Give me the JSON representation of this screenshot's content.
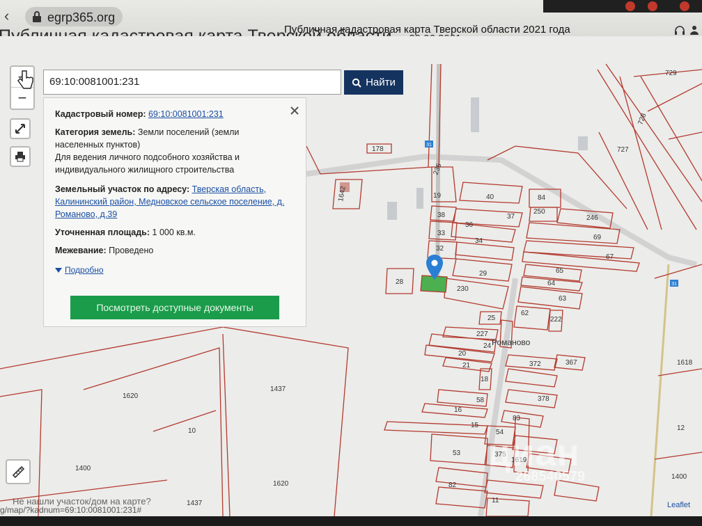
{
  "browser": {
    "url": "egrp365.org",
    "tab_title": "Публичная кадастровая карта Тверской области 2021 года"
  },
  "page": {
    "heading": "Публичная кадастровая карта Тверской области",
    "heading_date": "на 29.06.2021"
  },
  "search": {
    "value": "69:10:0081001:231",
    "button_label": "Найти"
  },
  "popup": {
    "cadastral_label": "Кадастровый номер:",
    "cadastral_value": "69:10:0081001:231",
    "category_label": "Категория земель:",
    "category_value_1": "Земли поселений (земли",
    "category_value_2": "населенных пунктов)",
    "usage_1": "Для ведения личного подсобного хозяйства и",
    "usage_2": "индивидуального жилищного строительства",
    "address_label": "Земельный участок по адресу:",
    "address_1": "Тверская область,",
    "address_2": "Калининский район, Медновское сельское поселение, д.",
    "address_3": "Романово, д.39",
    "area_label": "Уточненная площадь:",
    "area_value": "1 000 кв.м.",
    "survey_label": "Межевание:",
    "survey_value": "Проведено",
    "more_link": "Подробно",
    "docs_button": "Посмотреть доступные документы"
  },
  "map": {
    "parcel_labels": [
      "729",
      "728",
      "727",
      "178",
      "236",
      "19",
      "1642",
      "40",
      "84",
      "250",
      "246",
      "38",
      "36",
      "37",
      "69",
      "33",
      "34",
      "32",
      "67",
      "65",
      "28",
      "29",
      "64",
      "230",
      "63",
      "62",
      "222",
      "25",
      "227",
      "24",
      "20",
      "21",
      "372",
      "367",
      "1618",
      "18",
      "58",
      "378",
      "16",
      "83",
      "15",
      "54",
      "12",
      "53",
      "375",
      "1619",
      "1400",
      "1620",
      "1437",
      "10",
      "82",
      "11"
    ],
    "place_name": "Романово",
    "sign_badge": "31"
  },
  "footer": {
    "status_url": "g/map/?kadnum=69:10:0081001:231#",
    "not_found": "Не нашли участок/дом на карте?",
    "leaflet": "Leaflet"
  },
  "watermark": {
    "brand": "циан",
    "id": "268540579"
  },
  "colors": {
    "parcel_line": "#b23a2e",
    "selected_parcel": "#4caf50",
    "marker": "#2a7fd4",
    "search_button": "#14335f",
    "docs_button": "#1a9c4a"
  }
}
